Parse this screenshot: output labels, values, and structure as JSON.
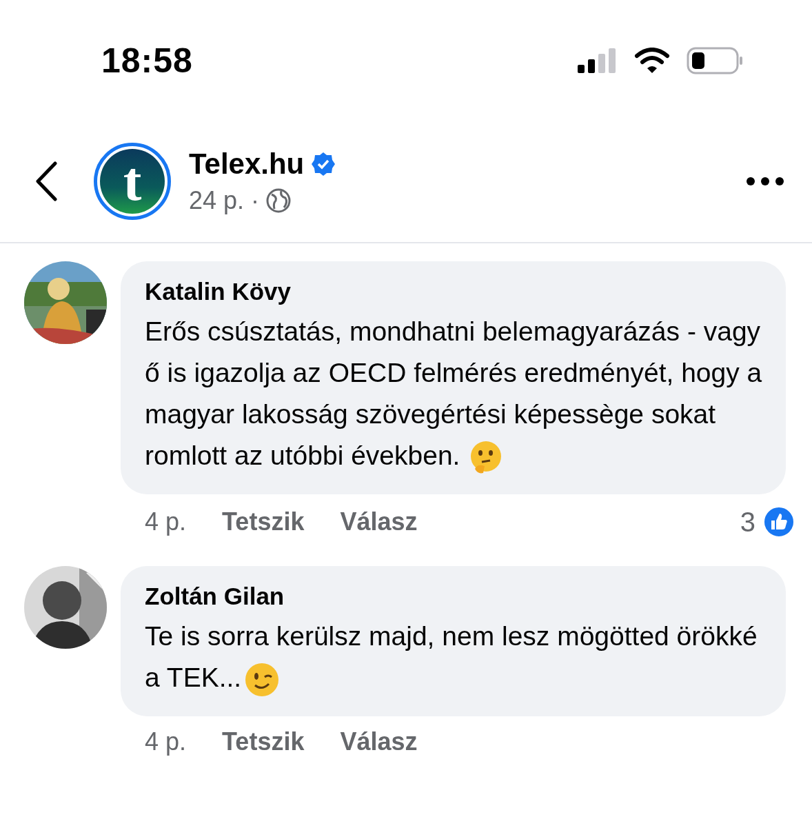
{
  "status_bar": {
    "time": "18:58"
  },
  "header": {
    "logo_letter": "t",
    "page_name": "Telex.hu",
    "verified": true,
    "time": "24 p.",
    "separator": "·"
  },
  "comments": [
    {
      "author": "Katalin Kövy",
      "text": "Erős csúsztatás, mondhatni belemagyarázás - vagy ő is igazolja az OECD felmérés eredményét, hogy a magyar lakosság szövegértési képessège sokat romlott az utóbbi években.",
      "emoji": {
        "kind": "thinking"
      },
      "time": "4 p.",
      "like": "Tetszik",
      "reply": "Válasz",
      "reactions": "3"
    },
    {
      "author": "Zoltán Gilan",
      "text": "Te is sorra kerülsz majd, nem lesz mögötted örökké a TEK...",
      "emoji": {
        "kind": "wink"
      },
      "time": "4 p.",
      "like": "Tetszik",
      "reply": "Válasz"
    }
  ]
}
